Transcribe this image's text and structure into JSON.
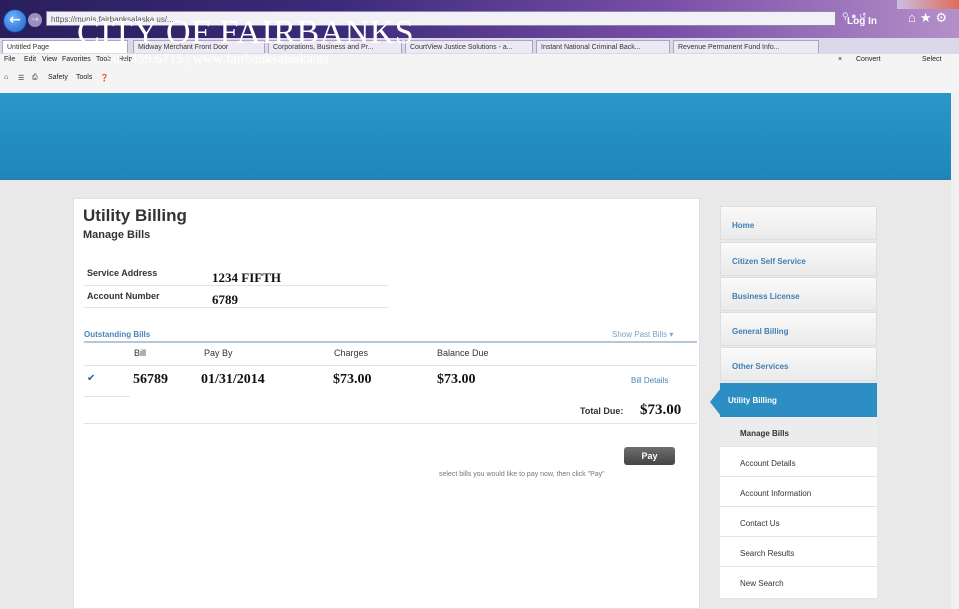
{
  "browser": {
    "address": "https://munis.fairbanksalaska.us/...",
    "tabs": [
      "Untitled Page",
      "Midway Merchant Front Door",
      "Corporations, Business and Pr...",
      "CourtView Justice Solutions - a...",
      "Instant National Criminal Back...",
      "Revenue Permanent Fund Info..."
    ],
    "menu": [
      "File",
      "Edit",
      "View",
      "Favorites",
      "Tools",
      "Help"
    ],
    "commands": [
      "Safety",
      "Tools"
    ],
    "right_commands": [
      "Convert",
      "Select"
    ]
  },
  "header": {
    "title": "CITY OF FAIRBANKS",
    "contact": "907.459.6715 | www.fairbanksalaska.us",
    "login": "Log In"
  },
  "page": {
    "title": "Utility Billing",
    "subtitle": "Manage Bills",
    "service_address_label": "Service Address",
    "service_address_value": "1234 FIFTH",
    "account_number_label": "Account Number",
    "account_number_value": "6789"
  },
  "bills": {
    "section_title": "Outstanding Bills",
    "show_past": "Show Past Bills ▾",
    "columns": [
      "Bill",
      "Pay By",
      "Charges",
      "Balance Due"
    ],
    "rows": [
      {
        "bill": "56789",
        "pay_by": "01/31/2014",
        "charges": "$73.00",
        "balance_due": "$73.00",
        "details": "Bill Details",
        "checked": true
      }
    ],
    "total_label": "Total Due:",
    "total_value": "$73.00",
    "pay_label": "Pay",
    "pay_hint": "select bills you would like to pay now, then click \"Pay\""
  },
  "sidebar": {
    "items": [
      "Home",
      "Citizen Self Service",
      "Business License",
      "General Billing",
      "Other Services"
    ],
    "active": "Utility Billing",
    "sub_items": [
      "Manage Bills",
      "Account Details",
      "Account Information",
      "Contact Us",
      "Search Results",
      "New Search"
    ]
  },
  "colors": {
    "header_blue": "#1f86b9",
    "active_blue": "#2c8ec2",
    "link_blue": "#3f7fb5"
  }
}
